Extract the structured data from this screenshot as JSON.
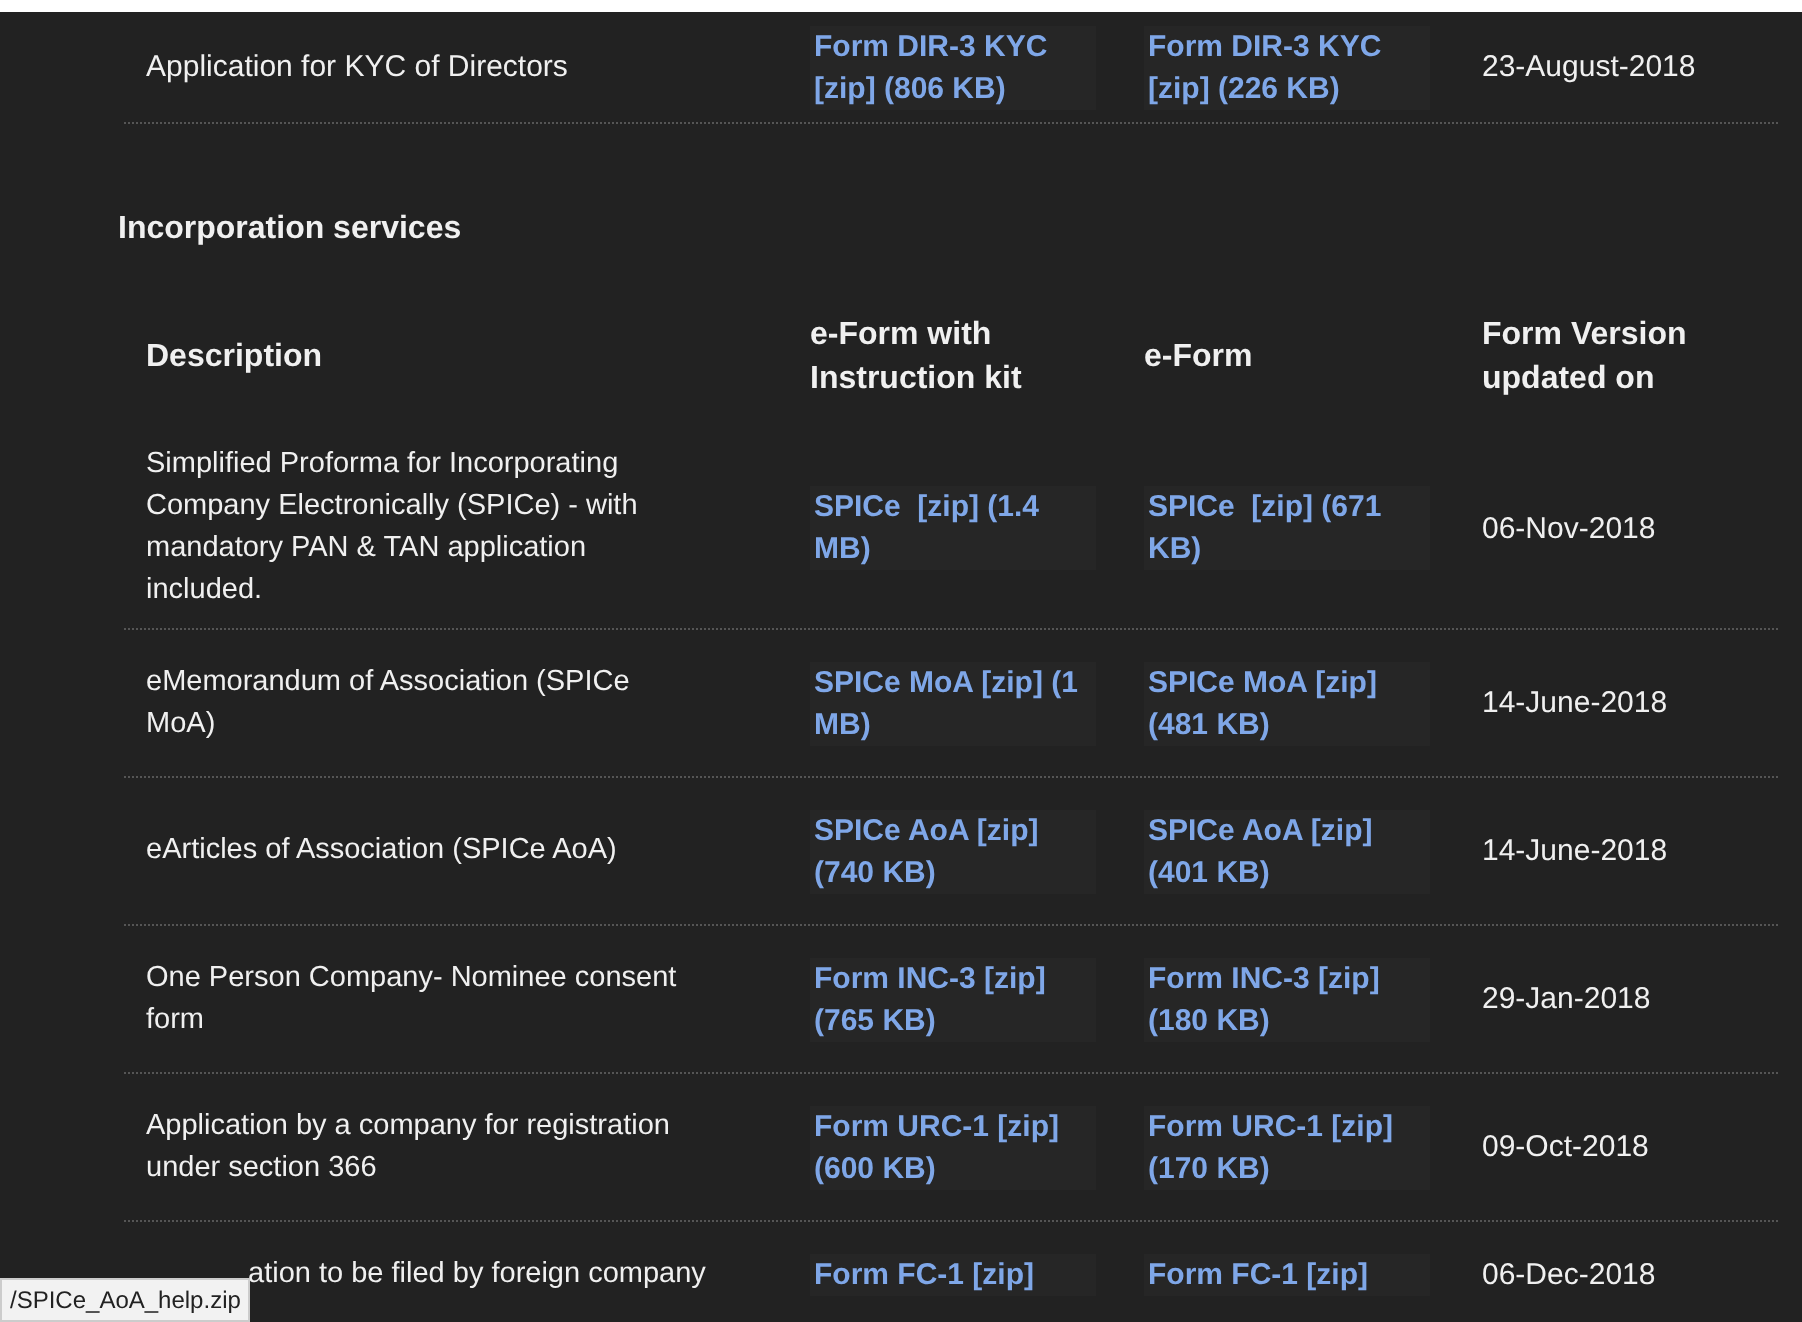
{
  "top_table": {
    "rows": [
      {
        "description": "Application for KYC of Directors",
        "instruction_kit": "Form DIR-3 KYC [zip] (806 KB)",
        "eform": "Form DIR-3 KYC [zip] (226 KB)",
        "updated_on": "23-August-2018"
      }
    ]
  },
  "section": {
    "title": "Incorporation services",
    "columns": [
      "Description",
      "e-Form with Instruction kit",
      "e-Form",
      "Form Version updated on"
    ],
    "rows": [
      {
        "description": "Simplified Proforma for Incorporating Company Electronically (SPICe) - with mandatory PAN & TAN application included.",
        "instruction_kit": "SPICe  [zip] (1.4 MB)",
        "eform": "SPICe  [zip] (671 KB)",
        "updated_on": "06-Nov-2018"
      },
      {
        "description": "eMemorandum of Association (SPICe MoA)",
        "instruction_kit": "SPICe MoA [zip] (1 MB)",
        "eform": "SPICe MoA [zip] (481 KB)",
        "updated_on": "14-June-2018"
      },
      {
        "description": "eArticles of Association (SPICe AoA)",
        "instruction_kit": "SPICe AoA [zip] (740 KB)",
        "eform": "SPICe AoA [zip] (401 KB)",
        "updated_on": "14-June-2018"
      },
      {
        "description": "One Person Company- Nominee consent form",
        "instruction_kit": "Form INC-3 [zip] (765 KB)",
        "eform": "Form INC-3 [zip] (180 KB)",
        "updated_on": "29-Jan-2018"
      },
      {
        "description": "Application by a company for registration under section 366",
        "instruction_kit": "Form URC-1 [zip] (600 KB)",
        "eform": "Form URC-1 [zip] (170 KB)",
        "updated_on": "09-Oct-2018"
      },
      {
        "description": "ation to be filed by foreign company",
        "instruction_kit": "Form FC-1 [zip]",
        "eform": "Form FC-1 [zip]",
        "updated_on": "06-Dec-2018",
        "partial": true
      }
    ]
  },
  "status_tooltip": "/SPICe_AoA_help.zip"
}
